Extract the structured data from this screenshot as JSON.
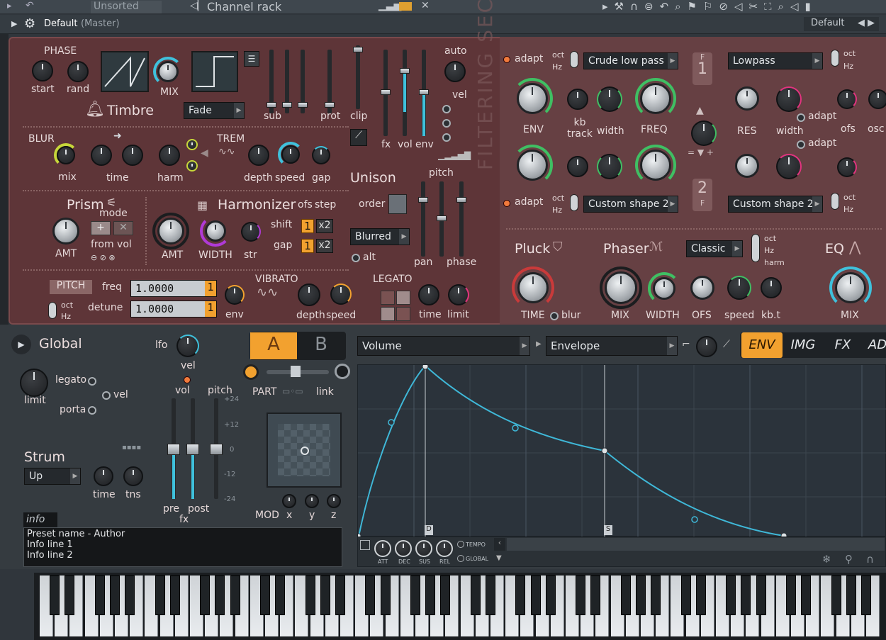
{
  "topbar": {
    "unsorted_label": "Unsorted",
    "channel_rack_label": "Channel rack"
  },
  "titlebar": {
    "preset_title": "Default",
    "preset_sub": "(Master)",
    "preset_right": "Default"
  },
  "phase": {
    "title": "PHASE",
    "start": "start",
    "rand": "rand",
    "mix": "MIX",
    "timbre": "Timbre",
    "fade_select": "Fade",
    "sub": "sub",
    "prot": "prot",
    "clip": "clip",
    "fx": "fx",
    "vol": "vol",
    "env": "env",
    "auto": "auto",
    "vel": "vel"
  },
  "blur": {
    "title": "BLUR",
    "mix": "mix",
    "time": "time",
    "harm": "harm",
    "trem": "TREM",
    "depth": "depth",
    "speed": "speed",
    "gap": "gap"
  },
  "unison": {
    "title": "Unison",
    "order": "order",
    "pitch": "pitch",
    "mode_select": "Blurred",
    "alt": "alt",
    "pan": "pan",
    "phase": "phase"
  },
  "prism": {
    "title": "Prism",
    "mode": "mode",
    "from_vol": "from vol",
    "amt": "AMT"
  },
  "harmonizer": {
    "title": "Harmonizer",
    "ofs": "ofs",
    "step": "step",
    "shift": "shift",
    "gap": "gap",
    "shift_val": "1",
    "shift_mult": "x2",
    "gap_val": "1",
    "gap_mult": "x2",
    "amt": "AMT",
    "width": "WIDTH",
    "str": "str"
  },
  "pitch": {
    "button": "PITCH",
    "freq": "freq",
    "detune": "detune",
    "freq_val": "1.0000",
    "freq_unit": "1",
    "detune_val": "1.0000",
    "detune_unit": "1",
    "oct": "oct",
    "hz": "Hz",
    "env": "env"
  },
  "vibrato": {
    "title": "VIBRATO",
    "depth": "depth",
    "speed": "speed"
  },
  "legato": {
    "title": "LEGATO",
    "time": "time",
    "limit": "limit"
  },
  "filtering": {
    "section_text": "FILTERING SECTION",
    "adapt": "adapt",
    "oct": "oct",
    "hz": "Hz",
    "filter1_type": "Crude low pass",
    "filter2_type": "Lowpass",
    "filter3_type": "Custom shape 2",
    "filter4_type": "Custom shape 2",
    "env": "ENV",
    "kb_track": "kb track",
    "width": "width",
    "freq": "FREQ",
    "res": "RES",
    "width2": "width",
    "adapt2": "adapt",
    "ofs": "ofs",
    "osc": "osc",
    "f1": "1",
    "f2": "2",
    "f_label": "F"
  },
  "pluck": {
    "title": "Pluck",
    "time": "TIME",
    "blur": "blur"
  },
  "phaser": {
    "title": "Phaser",
    "mode_select": "Classic",
    "oct": "oct",
    "hz": "Hz",
    "harm": "harm",
    "mix": "MIX",
    "width": "WIDTH",
    "ofs": "OFS",
    "speed": "speed",
    "kbt": "kb.t"
  },
  "eq": {
    "title": "EQ",
    "mix": "MIX"
  },
  "global": {
    "title": "Global",
    "lfo": "lfo",
    "vel": "vel",
    "limit": "limit",
    "legato": "legato",
    "vel2": "vel",
    "porta": "porta",
    "vol": "vol",
    "pitch": "pitch",
    "pre": "pre",
    "post": "post",
    "fx": "fx",
    "strum": "Strum",
    "strum_select": "Up",
    "time": "time",
    "tns": "tns",
    "info_tab": "info",
    "info_lines": [
      "Preset name - Author",
      "Info line 1",
      "Info line 2"
    ],
    "scale": [
      "+24",
      "+12",
      "0",
      "-12",
      "-24"
    ]
  },
  "ab": {
    "a": "A",
    "b": "B",
    "part": "PART",
    "link": "link",
    "mod": "MOD",
    "x": "x",
    "y": "y",
    "z": "z"
  },
  "envelope": {
    "target_select": "Volume",
    "mode_select": "Envelope",
    "tabs": [
      "ENV",
      "IMG",
      "FX",
      "AD"
    ],
    "active_tab": "ENV",
    "att": "ATT",
    "dec": "DEC",
    "sus": "SUS",
    "rel": "REL",
    "tempo": "TEMPO",
    "global": "GLOBAL",
    "marker_d": "D",
    "marker_s": "S"
  },
  "colors": {
    "accent_orange": "#f2a12f",
    "accent_teal": "#3fc1dc",
    "accent_green": "#3fbf63",
    "accent_pink": "#e2347f",
    "panel": "#5e3538"
  }
}
